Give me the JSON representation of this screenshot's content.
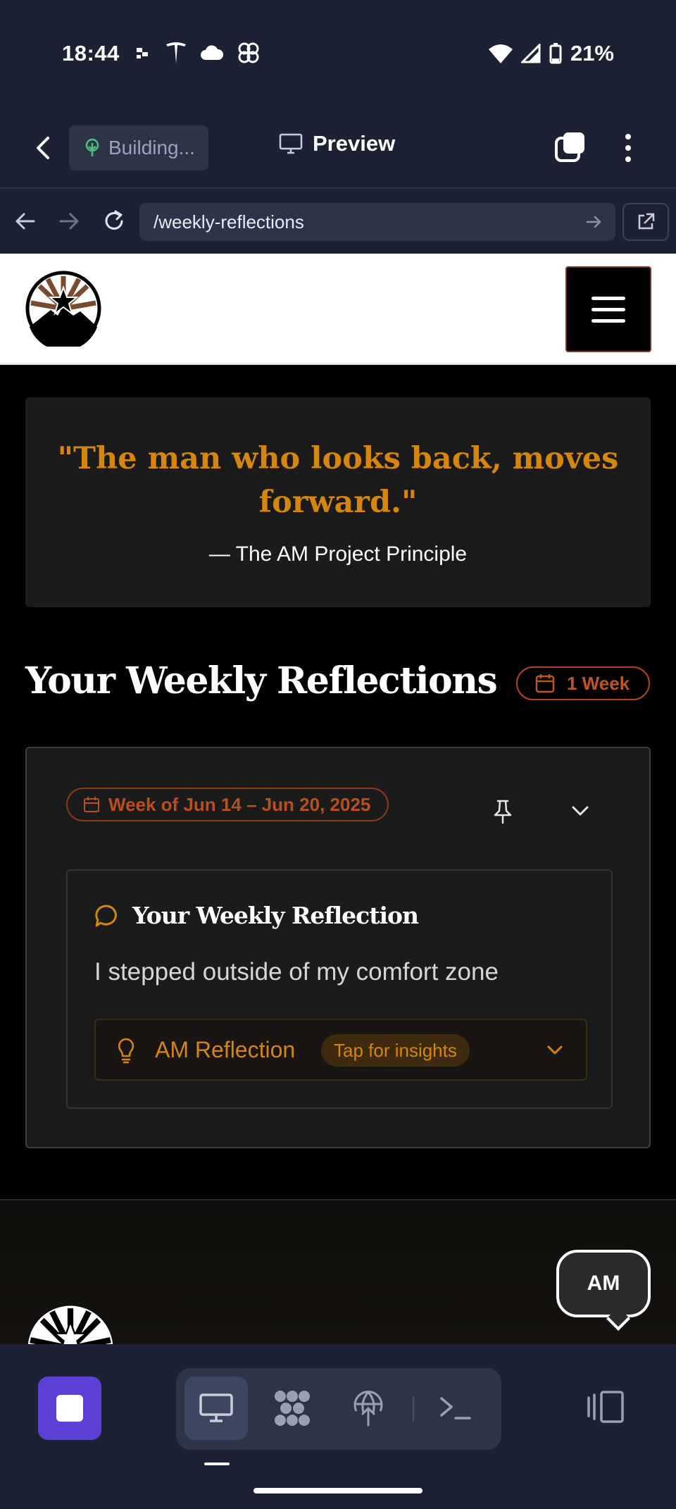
{
  "status_bar": {
    "time": "18:44",
    "battery": "21%"
  },
  "app_toolbar": {
    "building_label": "Building...",
    "preview_label": "Preview"
  },
  "url_bar": {
    "url": "/weekly-reflections"
  },
  "quote": {
    "text": "\"The man who looks back, moves forward.\"",
    "attribution": "— The AM Project Principle"
  },
  "section": {
    "title": "Your Weekly Reflections",
    "badge": "1 Week"
  },
  "entry": {
    "week_label": "Week of Jun 14 – Jun 20, 2025",
    "reflection_title": "Your Weekly Reflection",
    "reflection_text": "I stepped outside of my comfort zone",
    "am_reflection_label": "AM Reflection",
    "tap_label": "Tap for insights"
  },
  "chat_button": {
    "label": "AM"
  },
  "colors": {
    "accent": "#d4860e",
    "rust": "#b7501e",
    "dock_primary": "#5b3fd6"
  }
}
